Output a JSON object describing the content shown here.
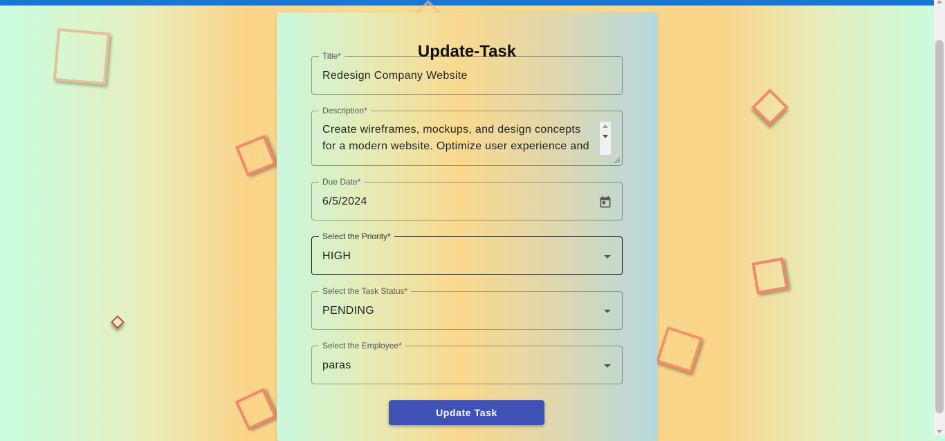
{
  "form": {
    "heading": "Update-Task",
    "title_field": {
      "label": "Title*",
      "value": "Redesign Company Website"
    },
    "description_field": {
      "label": "Description*",
      "value": "Create wireframes, mockups, and design concepts for a modern website. Optimize user experience and"
    },
    "due_date_field": {
      "label": "Due Date*",
      "value": "6/5/2024",
      "icon": "calendar-icon"
    },
    "priority_field": {
      "label": "Select the Priority*",
      "value": "HIGH",
      "icon": "chevron-down-icon"
    },
    "status_field": {
      "label": "Select the Task Status*",
      "value": "PENDING",
      "icon": "chevron-down-icon"
    },
    "employee_field": {
      "label": "Select the Employee*",
      "value": "paras",
      "icon": "chevron-down-icon"
    },
    "submit_label": "Update Task"
  },
  "colors": {
    "top_bar": "#1976d2",
    "button": "#3f51b5",
    "square_border": "#f08a6a"
  }
}
